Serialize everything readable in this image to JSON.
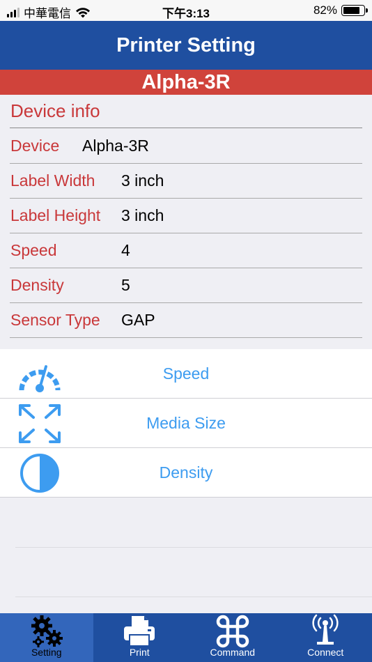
{
  "status_bar": {
    "carrier": "中華電信",
    "time": "下午3:13",
    "battery_percent": "82%",
    "battery_level": 0.82
  },
  "header": {
    "title": "Printer Setting",
    "model": "Alpha-3R"
  },
  "device_info": {
    "section_title": "Device info",
    "rows": [
      {
        "label": "Device",
        "value": "Alpha-3R"
      },
      {
        "label": "Label Width",
        "value": "3 inch"
      },
      {
        "label": "Label Height",
        "value": "3 inch"
      },
      {
        "label": "Speed",
        "value": "4"
      },
      {
        "label": "Density",
        "value": "5"
      },
      {
        "label": "Sensor Type",
        "value": "GAP"
      }
    ]
  },
  "menu": {
    "items": [
      {
        "label": "Speed",
        "icon": "speedometer-icon"
      },
      {
        "label": "Media Size",
        "icon": "expand-arrows-icon"
      },
      {
        "label": "Density",
        "icon": "half-circle-icon"
      }
    ]
  },
  "tabbar": {
    "tabs": [
      {
        "label": "Setting",
        "icon": "gears-icon",
        "active": true
      },
      {
        "label": "Print",
        "icon": "printer-icon",
        "active": false
      },
      {
        "label": "Command",
        "icon": "command-key-icon",
        "active": false
      },
      {
        "label": "Connect",
        "icon": "antenna-icon",
        "active": false
      }
    ]
  },
  "colors": {
    "nav_blue": "#1f4fa0",
    "model_red": "#d0433b",
    "label_red": "#c9383a",
    "menu_blue": "#3d9cf0"
  }
}
